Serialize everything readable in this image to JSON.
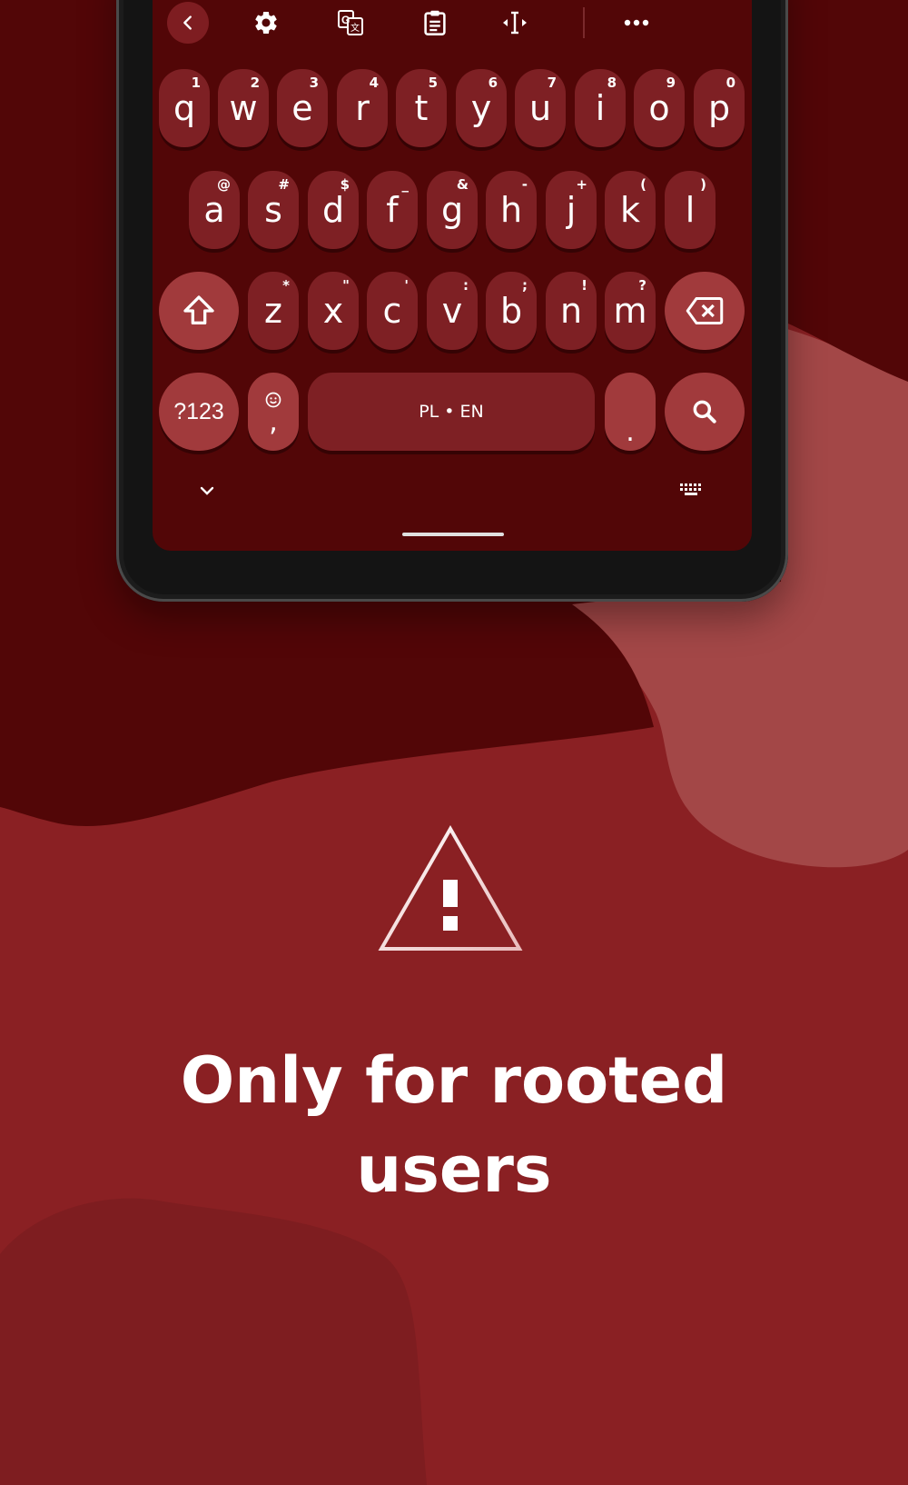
{
  "colors": {
    "background": "#8a2023",
    "dark_blob": "#520607",
    "light_blob": "#a34747",
    "key": "#7e2024",
    "key_special": "#a13a3c",
    "text": "#ffffff"
  },
  "toolbar": {
    "icons": [
      "chevron-left-icon",
      "gear-icon",
      "translate-icon",
      "clipboard-icon",
      "cursor-move-icon",
      "more-icon"
    ]
  },
  "keyboard": {
    "row1": [
      {
        "label": "q",
        "hint": "1"
      },
      {
        "label": "w",
        "hint": "2"
      },
      {
        "label": "e",
        "hint": "3"
      },
      {
        "label": "r",
        "hint": "4"
      },
      {
        "label": "t",
        "hint": "5"
      },
      {
        "label": "y",
        "hint": "6"
      },
      {
        "label": "u",
        "hint": "7"
      },
      {
        "label": "i",
        "hint": "8"
      },
      {
        "label": "o",
        "hint": "9"
      },
      {
        "label": "p",
        "hint": "0"
      }
    ],
    "row2": [
      {
        "label": "a",
        "hint": "@"
      },
      {
        "label": "s",
        "hint": "#"
      },
      {
        "label": "d",
        "hint": "$"
      },
      {
        "label": "f",
        "hint": "_"
      },
      {
        "label": "g",
        "hint": "&"
      },
      {
        "label": "h",
        "hint": "-"
      },
      {
        "label": "j",
        "hint": "+"
      },
      {
        "label": "k",
        "hint": "("
      },
      {
        "label": "l",
        "hint": ")"
      }
    ],
    "row3": [
      {
        "label": "z",
        "hint": "*"
      },
      {
        "label": "x",
        "hint": "\""
      },
      {
        "label": "c",
        "hint": "'"
      },
      {
        "label": "v",
        "hint": ":"
      },
      {
        "label": "b",
        "hint": ";"
      },
      {
        "label": "n",
        "hint": "!"
      },
      {
        "label": "m",
        "hint": "?"
      }
    ],
    "symbols_key": "?123",
    "comma_key": ",",
    "space_label": "PL • EN",
    "period_key": "."
  },
  "headline": {
    "line1": "Only for rooted",
    "line2": "users"
  }
}
